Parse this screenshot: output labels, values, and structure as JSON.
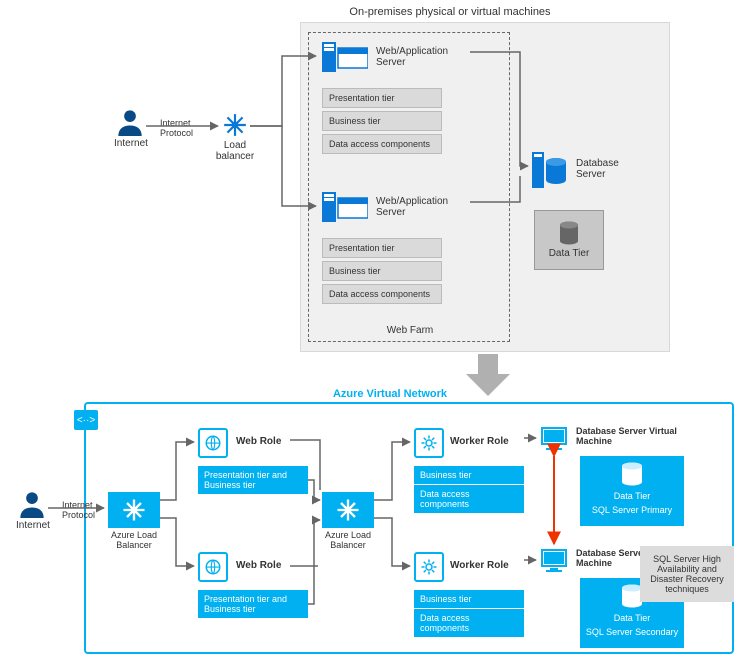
{
  "onprem": {
    "title": "On-premises physical or virtual machines",
    "internet": "Internet",
    "internet_protocol": "Internet Protocol",
    "load_balancer": "Load balancer",
    "web_app_server": "Web/Application Server",
    "tiers": {
      "presentation": "Presentation tier",
      "business": "Business tier",
      "data_access": "Data access components"
    },
    "web_farm": "Web Farm",
    "db_server": "Database Server",
    "data_tier": "Data Tier"
  },
  "azure": {
    "title": "Azure Virtual Network",
    "internet": "Internet",
    "internet_protocol": "Internet Protocol",
    "azure_lb": "Azure Load Balancer",
    "web_role": "Web Role",
    "worker_role": "Worker Role",
    "web_tier": "Presentation tier and Business tier",
    "worker_business": "Business tier",
    "worker_data_access": "Data access components",
    "db_vm": "Database Server Virtual Machine",
    "data_tier": "Data Tier",
    "sql_primary": "SQL Server Primary",
    "sql_secondary": "SQL Server Secondary",
    "hadr": "SQL Server High Availability and Disaster Recovery techniques"
  }
}
